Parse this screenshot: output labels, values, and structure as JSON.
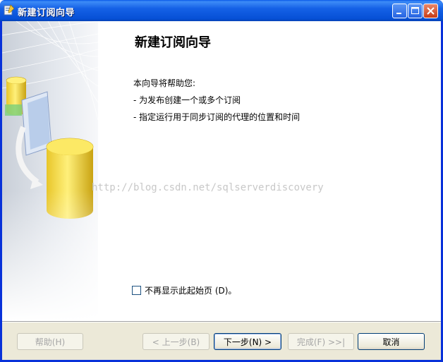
{
  "window": {
    "title": "新建订阅向导"
  },
  "page": {
    "heading": "新建订阅向导",
    "intro": "本向导将帮助您:",
    "bullets": [
      "- 为发布创建一个或多个订阅",
      "- 指定运行用于同步订阅的代理的位置和时间"
    ]
  },
  "watermark": "http://blog.csdn.net/sqlserverdiscovery",
  "options": {
    "hide_start_page_label": "不再显示此起始页 (D)。",
    "hide_start_page_checked": false
  },
  "buttons": {
    "help": "帮助(H)",
    "back": "< 上一步(B)",
    "next": "下一步(N) >",
    "finish": "完成(F) >>|",
    "cancel": "取消"
  },
  "colors": {
    "titlebar": "#0a5ae8",
    "footer": "#ece9d8",
    "accent_yellow": "#f2d83a"
  }
}
